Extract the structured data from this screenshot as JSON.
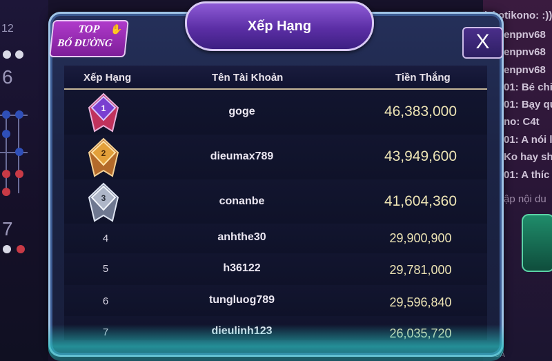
{
  "background": {
    "left_numbers": [
      "12",
      "6",
      "7"
    ],
    "chat_lines": [
      "lzkotikono: :))",
      "enpnv68",
      "enpnv68",
      "enpnv68",
      "01: Bé chi",
      "01: Bạy qu",
      "no: C4t",
      "01: A nói l",
      "Ko hay sh",
      "01: A thíc",
      "ập nội du"
    ],
    "hoa_label": "HOA"
  },
  "modal": {
    "title": "Xếp Hạng",
    "badge_line1": "TOP",
    "badge_line2": "BỐ ĐƯỜNG",
    "close_label": "X",
    "columns": [
      "Xếp Hạng",
      "Tên Tài Khoản",
      "Tiền Thắng"
    ],
    "rows": [
      {
        "rank": "1",
        "name": "goge",
        "money": "46,383,000"
      },
      {
        "rank": "2",
        "name": "dieumax789",
        "money": "43,949,600"
      },
      {
        "rank": "3",
        "name": "conanbe",
        "money": "41,604,360"
      },
      {
        "rank": "4",
        "name": "anhthe30",
        "money": "29,900,900"
      },
      {
        "rank": "5",
        "name": "h36122",
        "money": "29,781,000"
      },
      {
        "rank": "6",
        "name": "tungluog789",
        "money": "29,596,840"
      },
      {
        "rank": "7",
        "name": "dieulinh123",
        "money": "26,035,720"
      }
    ]
  },
  "colors": {
    "gold_text": "#ece3b4",
    "medal_1": "#7a3fd0",
    "medal_2": "#d08a2a",
    "medal_3": "#9aa3b8"
  }
}
